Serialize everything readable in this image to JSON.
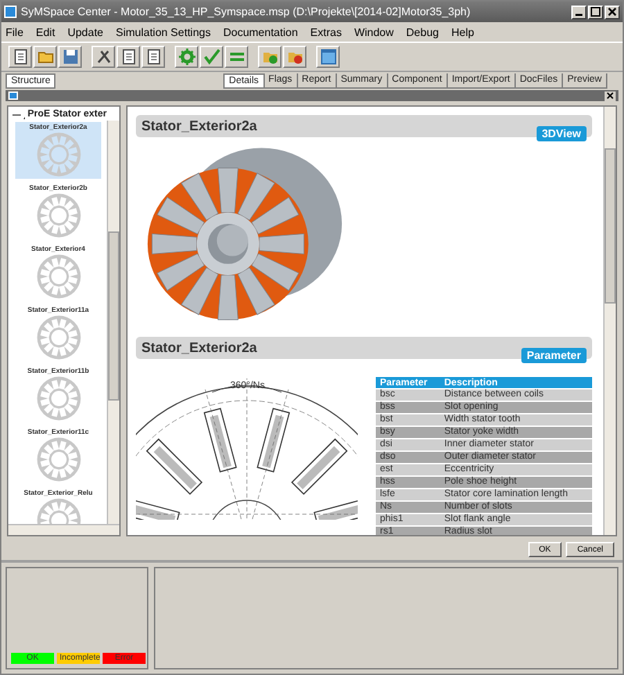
{
  "window": {
    "title": "SyMSpace Center - Motor_35_13_HP_Symspace.msp (D:\\Projekte\\[2014-02]Motor35_3ph)"
  },
  "menu": [
    "File",
    "Edit",
    "Update",
    "Simulation Settings",
    "Documentation",
    "Extras",
    "Window",
    "Debug",
    "Help"
  ],
  "left_tabs": [
    {
      "label": "Structure",
      "selected": true
    }
  ],
  "right_tabs": [
    {
      "label": "Details",
      "selected": true
    },
    {
      "label": "Flags",
      "selected": false
    },
    {
      "label": "Report",
      "selected": false
    },
    {
      "label": "Summary",
      "selected": false
    },
    {
      "label": "Component",
      "selected": false
    },
    {
      "label": "Import/Export",
      "selected": false
    },
    {
      "label": "DocFiles",
      "selected": false
    },
    {
      "label": "Preview",
      "selected": false
    }
  ],
  "tree": {
    "label": "ProE Stator exter",
    "expanded": true,
    "items": [
      {
        "label": "Stator_Exterior2a",
        "selected": true
      },
      {
        "label": "Stator_Exterior2b",
        "selected": false
      },
      {
        "label": "Stator_Exterior4",
        "selected": false
      },
      {
        "label": "Stator_Exterior11a",
        "selected": false
      },
      {
        "label": "Stator_Exterior11b",
        "selected": false
      },
      {
        "label": "Stator_Exterior11c",
        "selected": false
      },
      {
        "label": "Stator_Exterior_Relu",
        "selected": false
      }
    ]
  },
  "sections": [
    {
      "kind": "view",
      "title": "Stator_Exterior2a",
      "badge": "3DView"
    },
    {
      "kind": "parameter",
      "title": "Stator_Exterior2a",
      "badge": "Parameter",
      "drawing_label": "360°/Ns"
    }
  ],
  "parameters": {
    "columns": [
      "Parameter",
      "Description"
    ],
    "rows": [
      [
        "bsc",
        "Distance between coils"
      ],
      [
        "bss",
        "Slot opening"
      ],
      [
        "bst",
        "Width stator tooth"
      ],
      [
        "bsy",
        "Stator yoke width"
      ],
      [
        "dsi",
        "Inner diameter stator"
      ],
      [
        "dso",
        "Outer diameter stator"
      ],
      [
        "est",
        "Eccentricity"
      ],
      [
        "hss",
        "Pole shoe height"
      ],
      [
        "lsfe",
        "Stator core lamination length"
      ],
      [
        "Ns",
        "Number of slots"
      ],
      [
        "phis1",
        "Slot flank angle"
      ],
      [
        "rs1",
        "Radius slot"
      ]
    ]
  },
  "buttons": [
    "OK",
    "Cancel"
  ],
  "legend": [
    {
      "label": "OK",
      "color": "#00ff00"
    },
    {
      "label": "Incomplete",
      "color": "#ffcc00"
    },
    {
      "label": "Error",
      "color": "#ff0000"
    }
  ]
}
